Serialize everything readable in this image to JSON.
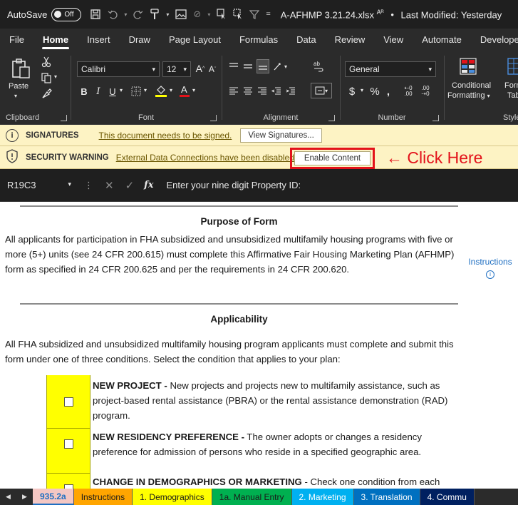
{
  "titlebar": {
    "autosave_label": "AutoSave",
    "autosave_state": "Off",
    "filename": "A-AFHMP 3.21.24.xlsx",
    "modified": "Last Modified: Yesterday"
  },
  "tabs": [
    "File",
    "Home",
    "Insert",
    "Draw",
    "Page Layout",
    "Formulas",
    "Data",
    "Review",
    "View",
    "Automate",
    "Develope"
  ],
  "ribbon": {
    "clipboard_label": "Clipboard",
    "paste_label": "Paste",
    "font_label": "Font",
    "font_name": "Calibri",
    "font_size": "12",
    "alignment_label": "Alignment",
    "number_label": "Number",
    "number_format": "General",
    "conditional_label": "Conditional",
    "formatting_label": "Formatting",
    "format_as_label": "Form",
    "table_label": "Tab",
    "styles_label": "Styles"
  },
  "signatures_bar": {
    "title": "SIGNATURES",
    "message": "This document needs to be signed.",
    "button": "View Signatures..."
  },
  "security_bar": {
    "title": "SECURITY WARNING",
    "message": "External Data Connections have been disabled",
    "button": "Enable Content",
    "annotation": "← Click Here"
  },
  "formula_bar": {
    "cell_ref": "R19C3",
    "content": "Enter your nine digit Property ID:"
  },
  "sheet": {
    "purpose_heading": "Purpose of Form",
    "purpose_text": "All applicants for participation in FHA subsidized and unsubsidized multifamily housing programs with five or more (5+) units (see 24 CFR 200.615) must complete this Affirmative Fair Housing Marketing Plan (AFHMP) form as specified in 24 CFR 200.625 and per the requirements in 24 CFR 200.620.",
    "instructions_link": "Instructions",
    "applicability_heading": "Applicability",
    "applicability_text": "All FHA subsidized and unsubsidized multifamily housing program applicants must complete and submit this form under one of three conditions. Select the condition that applies to your plan:",
    "options": [
      {
        "title": "NEW PROJECT -",
        "text": " New projects and projects new to multifamily assistance, such as project-based rental assistance (PBRA) or the rental assistance demonstration (RAD) program."
      },
      {
        "title": "NEW RESIDENCY PREFERENCE -",
        "text": " The owner adopts or changes a residency preference for admission of persons who reside in a specified geographic area."
      },
      {
        "title": "CHANGE IN DEMOGRAPHICS OR MARKETING",
        "text": " - Check one condition from each"
      }
    ]
  },
  "sheet_tabs": [
    {
      "label": "935.2a",
      "bg": "#f4c7c3",
      "fg": "#1f6fc2"
    },
    {
      "label": "Instructions",
      "bg": "#ffa500",
      "fg": "#1a1a1a"
    },
    {
      "label": "1. Demographics",
      "bg": "#ffff00",
      "fg": "#1a1a1a"
    },
    {
      "label": "1a. Manual Entry",
      "bg": "#00b050",
      "fg": "#1a1a1a"
    },
    {
      "label": "2. Marketing",
      "bg": "#00b0f0",
      "fg": "#ffffff"
    },
    {
      "label": "3. Translation",
      "bg": "#0070c0",
      "fg": "#ffffff"
    },
    {
      "label": "4. Commu",
      "bg": "#002060",
      "fg": "#ffffff"
    }
  ],
  "colors": {
    "accent_red": "#e3121a",
    "message_bar": "#fdf3c4",
    "highlight_yellow": "#ffff00"
  }
}
